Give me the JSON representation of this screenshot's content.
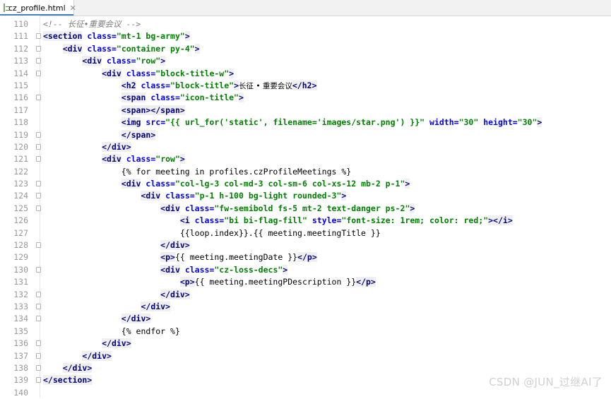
{
  "tab": {
    "filename": "cz_profile.html",
    "close_glyph": "✕",
    "icon": "html-file-icon"
  },
  "watermark": "CSDN @JUN_过继AI了",
  "lines": [
    {
      "n": "110",
      "fold": false,
      "indent": "",
      "tokens": [
        {
          "t": "cm",
          "v": "<!-- 长征•重要会议 -->"
        }
      ]
    },
    {
      "n": "111",
      "fold": true,
      "indent": "",
      "tokens": [
        {
          "t": "tg",
          "v": "<section"
        },
        {
          "t": "tx",
          "v": " "
        },
        {
          "t": "an",
          "v": "class="
        },
        {
          "t": "av",
          "v": "\"mt-1 bg-army\""
        },
        {
          "t": "tg",
          "v": ">"
        }
      ]
    },
    {
      "n": "112",
      "fold": true,
      "indent": "    ",
      "tokens": [
        {
          "t": "tg",
          "v": "<div"
        },
        {
          "t": "tx",
          "v": " "
        },
        {
          "t": "an",
          "v": "class="
        },
        {
          "t": "av",
          "v": "\"container py-4\""
        },
        {
          "t": "tg",
          "v": ">"
        }
      ]
    },
    {
      "n": "113",
      "fold": true,
      "indent": "        ",
      "tokens": [
        {
          "t": "tg",
          "v": "<div"
        },
        {
          "t": "tx",
          "v": " "
        },
        {
          "t": "an",
          "v": "class="
        },
        {
          "t": "av",
          "v": "\"row\""
        },
        {
          "t": "tg",
          "v": ">"
        }
      ]
    },
    {
      "n": "114",
      "fold": true,
      "indent": "            ",
      "tokens": [
        {
          "t": "tg",
          "v": "<div"
        },
        {
          "t": "tx",
          "v": " "
        },
        {
          "t": "an",
          "v": "class="
        },
        {
          "t": "av",
          "v": "\"block-title-w\""
        },
        {
          "t": "tg",
          "v": ">"
        }
      ]
    },
    {
      "n": "115",
      "fold": false,
      "indent": "                ",
      "tokens": [
        {
          "t": "tg",
          "v": "<h2"
        },
        {
          "t": "tx",
          "v": " "
        },
        {
          "t": "an",
          "v": "class="
        },
        {
          "t": "av",
          "v": "\"block-title\""
        },
        {
          "t": "tg",
          "v": ">"
        },
        {
          "t": "cjk",
          "v": "长征 • 重要会议"
        },
        {
          "t": "tg",
          "v": "</h2>"
        }
      ]
    },
    {
      "n": "116",
      "fold": true,
      "indent": "                ",
      "tokens": [
        {
          "t": "tg",
          "v": "<span"
        },
        {
          "t": "tx",
          "v": " "
        },
        {
          "t": "an",
          "v": "class="
        },
        {
          "t": "av",
          "v": "\"icon-title\""
        },
        {
          "t": "tg",
          "v": ">"
        }
      ]
    },
    {
      "n": "117",
      "fold": false,
      "indent": "                ",
      "tokens": [
        {
          "t": "tg",
          "v": "<span></span>"
        }
      ]
    },
    {
      "n": "118",
      "fold": false,
      "indent": "                ",
      "tokens": [
        {
          "t": "tg",
          "v": "<img"
        },
        {
          "t": "tx",
          "v": " "
        },
        {
          "t": "an",
          "v": "src="
        },
        {
          "t": "av",
          "v": "\"{{ url_for('static', filename='images/star.png') }}\""
        },
        {
          "t": "tx",
          "v": " "
        },
        {
          "t": "an",
          "v": "width="
        },
        {
          "t": "av",
          "v": "\"30\""
        },
        {
          "t": "tx",
          "v": " "
        },
        {
          "t": "an",
          "v": "height="
        },
        {
          "t": "av",
          "v": "\"30\""
        },
        {
          "t": "tg",
          "v": ">"
        }
      ]
    },
    {
      "n": "119",
      "fold": true,
      "indent": "                ",
      "tokens": [
        {
          "t": "tg",
          "v": "</span>"
        }
      ]
    },
    {
      "n": "120",
      "fold": true,
      "indent": "            ",
      "tokens": [
        {
          "t": "tg",
          "v": "</div>"
        }
      ]
    },
    {
      "n": "121",
      "fold": true,
      "indent": "            ",
      "tokens": [
        {
          "t": "tg",
          "v": "<div"
        },
        {
          "t": "tx",
          "v": " "
        },
        {
          "t": "an",
          "v": "class="
        },
        {
          "t": "av",
          "v": "\"row\""
        },
        {
          "t": "tg",
          "v": ">"
        }
      ]
    },
    {
      "n": "122",
      "fold": false,
      "indent": "                ",
      "tokens": [
        {
          "t": "tx",
          "v": "{% for meeting in profiles.czProfileMeetings %}"
        }
      ]
    },
    {
      "n": "123",
      "fold": true,
      "indent": "                ",
      "tokens": [
        {
          "t": "tg",
          "v": "<div"
        },
        {
          "t": "tx",
          "v": " "
        },
        {
          "t": "an",
          "v": "class="
        },
        {
          "t": "av",
          "v": "\"col-lg-3 col-md-3 col-sm-6 col-xs-12 mb-2 p-1\""
        },
        {
          "t": "tg",
          "v": ">"
        }
      ]
    },
    {
      "n": "124",
      "fold": true,
      "indent": "                    ",
      "tokens": [
        {
          "t": "tg",
          "v": "<div"
        },
        {
          "t": "tx",
          "v": " "
        },
        {
          "t": "an",
          "v": "class="
        },
        {
          "t": "av",
          "v": "\"p-1 h-100 bg-light rounded-3\""
        },
        {
          "t": "tg",
          "v": ">"
        }
      ]
    },
    {
      "n": "125",
      "fold": true,
      "indent": "                        ",
      "tokens": [
        {
          "t": "tg",
          "v": "<div"
        },
        {
          "t": "tx",
          "v": " "
        },
        {
          "t": "an",
          "v": "class="
        },
        {
          "t": "av",
          "v": "\"fw-semibold fs-5 mt-2 text-danger ps-2\""
        },
        {
          "t": "tg",
          "v": ">"
        }
      ]
    },
    {
      "n": "126",
      "fold": false,
      "indent": "                            ",
      "tokens": [
        {
          "t": "tg",
          "v": "<i"
        },
        {
          "t": "tx",
          "v": " "
        },
        {
          "t": "an",
          "v": "class="
        },
        {
          "t": "av",
          "v": "\"bi bi-flag-fill\""
        },
        {
          "t": "tx",
          "v": " "
        },
        {
          "t": "an",
          "v": "style="
        },
        {
          "t": "av",
          "v": "\"font-size: 1rem; color: red;\""
        },
        {
          "t": "tg",
          "v": "></i>"
        }
      ]
    },
    {
      "n": "127",
      "fold": false,
      "indent": "                            ",
      "tokens": [
        {
          "t": "tx",
          "v": "{{loop.index}}.{{ meeting.meetingTitle }}"
        }
      ]
    },
    {
      "n": "128",
      "fold": true,
      "indent": "                        ",
      "tokens": [
        {
          "t": "tg",
          "v": "</div>"
        }
      ]
    },
    {
      "n": "129",
      "fold": false,
      "indent": "                        ",
      "tokens": [
        {
          "t": "tg",
          "v": "<p>"
        },
        {
          "t": "tx",
          "v": "{{ meeting.meetingDate }}"
        },
        {
          "t": "tg",
          "v": "</p>"
        }
      ]
    },
    {
      "n": "130",
      "fold": true,
      "indent": "                        ",
      "tokens": [
        {
          "t": "tg",
          "v": "<div"
        },
        {
          "t": "tx",
          "v": " "
        },
        {
          "t": "an",
          "v": "class="
        },
        {
          "t": "av",
          "v": "\"cz-loss-decs\""
        },
        {
          "t": "tg",
          "v": ">"
        }
      ]
    },
    {
      "n": "131",
      "fold": false,
      "indent": "                            ",
      "tokens": [
        {
          "t": "tg",
          "v": "<p>"
        },
        {
          "t": "tx",
          "v": "{{ meeting.meetingPDescription }}"
        },
        {
          "t": "tg",
          "v": "</p>"
        }
      ]
    },
    {
      "n": "132",
      "fold": true,
      "indent": "                        ",
      "tokens": [
        {
          "t": "tg",
          "v": "</div>"
        }
      ]
    },
    {
      "n": "133",
      "fold": true,
      "indent": "                    ",
      "tokens": [
        {
          "t": "tg",
          "v": "</div>"
        }
      ]
    },
    {
      "n": "134",
      "fold": true,
      "indent": "                ",
      "tokens": [
        {
          "t": "tg",
          "v": "</div>"
        }
      ]
    },
    {
      "n": "135",
      "fold": false,
      "indent": "                ",
      "tokens": [
        {
          "t": "tx",
          "v": "{% endfor %}"
        }
      ]
    },
    {
      "n": "136",
      "fold": true,
      "indent": "            ",
      "tokens": [
        {
          "t": "tg",
          "v": "</div>"
        }
      ]
    },
    {
      "n": "137",
      "fold": true,
      "indent": "        ",
      "tokens": [
        {
          "t": "tg",
          "v": "</div>"
        }
      ]
    },
    {
      "n": "138",
      "fold": true,
      "indent": "    ",
      "tokens": [
        {
          "t": "tg",
          "v": "</div>"
        }
      ]
    },
    {
      "n": "139",
      "fold": true,
      "indent": "",
      "tokens": [
        {
          "t": "tg",
          "v": "</section>"
        }
      ]
    },
    {
      "n": "140",
      "fold": false,
      "indent": "",
      "tokens": []
    }
  ]
}
